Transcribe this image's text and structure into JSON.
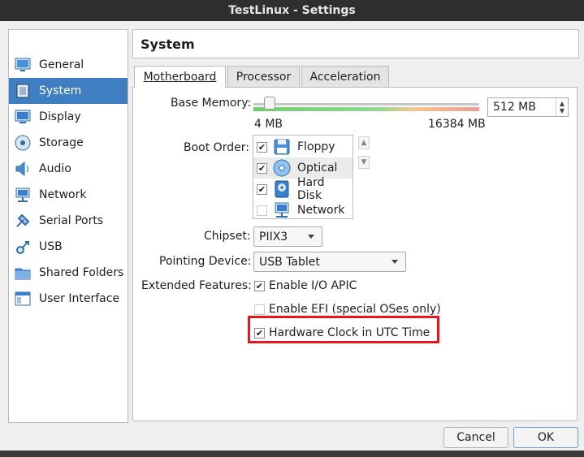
{
  "window": {
    "title": "TestLinux - Settings"
  },
  "sidebar": {
    "items": [
      {
        "label": "General",
        "icon": "general-icon",
        "selected": false
      },
      {
        "label": "System",
        "icon": "system-icon",
        "selected": true
      },
      {
        "label": "Display",
        "icon": "display-icon",
        "selected": false
      },
      {
        "label": "Storage",
        "icon": "storage-icon",
        "selected": false
      },
      {
        "label": "Audio",
        "icon": "audio-icon",
        "selected": false
      },
      {
        "label": "Network",
        "icon": "network-icon",
        "selected": false
      },
      {
        "label": "Serial Ports",
        "icon": "serial-ports-icon",
        "selected": false
      },
      {
        "label": "USB",
        "icon": "usb-icon",
        "selected": false
      },
      {
        "label": "Shared Folders",
        "icon": "shared-folders-icon",
        "selected": false
      },
      {
        "label": "User Interface",
        "icon": "user-interface-icon",
        "selected": false
      }
    ]
  },
  "page": {
    "title": "System"
  },
  "tabs": [
    {
      "label": "Motherboard",
      "active": true
    },
    {
      "label": "Processor",
      "active": false
    },
    {
      "label": "Acceleration",
      "active": false
    }
  ],
  "motherboard": {
    "base_memory": {
      "label": "Base Memory:",
      "value": "512 MB",
      "min_label": "4 MB",
      "max_label": "16384 MB",
      "value_mb": 512,
      "min_mb": 4,
      "max_mb": 16384
    },
    "boot_order": {
      "label": "Boot Order:",
      "items": [
        {
          "label": "Floppy",
          "checked": true,
          "icon": "floppy-icon"
        },
        {
          "label": "Optical",
          "checked": true,
          "icon": "optical-icon"
        },
        {
          "label": "Hard Disk",
          "checked": true,
          "icon": "hard-disk-icon"
        },
        {
          "label": "Network",
          "checked": false,
          "icon": "network-boot-icon"
        }
      ]
    },
    "chipset": {
      "label": "Chipset:",
      "value": "PIIX3"
    },
    "pointing_device": {
      "label": "Pointing Device:",
      "value": "USB Tablet"
    },
    "extended_features": {
      "label": "Extended Features:",
      "options": [
        {
          "label": "Enable I/O APIC",
          "checked": true
        },
        {
          "label": "Enable EFI (special OSes only)",
          "checked": false
        },
        {
          "label": "Hardware Clock in UTC Time",
          "checked": true
        }
      ]
    }
  },
  "buttons": {
    "cancel": "Cancel",
    "ok": "OK"
  },
  "colors": {
    "selection": "#3f7fc1",
    "highlight_box": "#e8151b",
    "titlebar": "#2f2f2f"
  }
}
